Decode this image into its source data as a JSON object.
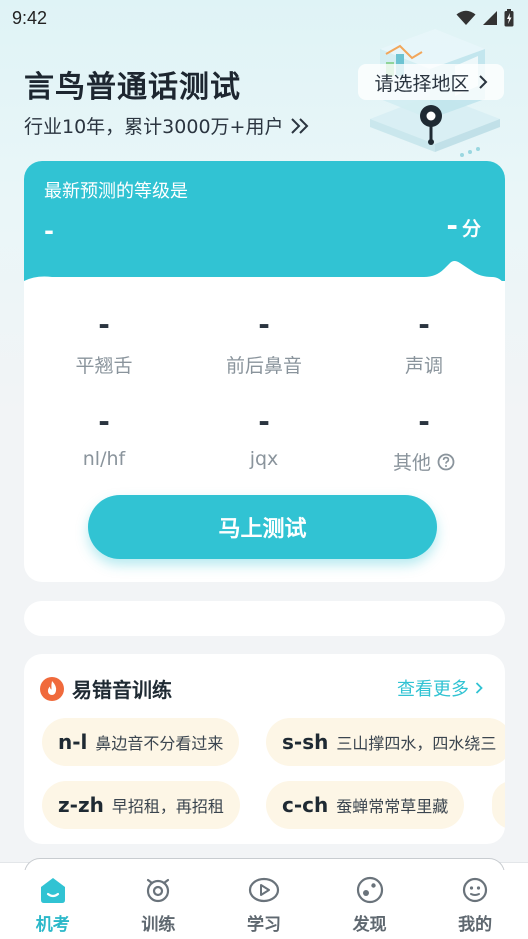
{
  "status_bar": {
    "time": "9:42"
  },
  "header": {
    "title": "言鸟普通话测试",
    "subtitle": "行业10年，累计3000万+用户",
    "region_button": "请选择地区"
  },
  "prediction": {
    "label": "最新预测的等级是",
    "level": "-",
    "score": "-",
    "score_unit": "分",
    "metrics": [
      {
        "value": "-",
        "label": "平翘舌"
      },
      {
        "value": "-",
        "label": "前后鼻音"
      },
      {
        "value": "-",
        "label": "声调"
      },
      {
        "value": "-",
        "label": "nl/hf"
      },
      {
        "value": "-",
        "label": "jqx"
      },
      {
        "value": "-",
        "label": "其他"
      }
    ],
    "test_button": "马上测试"
  },
  "practice": {
    "title": "易错音训练",
    "more_link": "查看更多",
    "items": [
      {
        "code": "n-l",
        "desc": "鼻边音不分看过来"
      },
      {
        "code": "s-sh",
        "desc": "三山撑四水，四水绕三"
      },
      {
        "code": "z-zh",
        "desc": "早招租，再招租"
      },
      {
        "code": "c-ch",
        "desc": "蚕蝉常常草里藏"
      }
    ]
  },
  "tabbar": {
    "tabs": [
      {
        "label": "机考",
        "icon": "exam-icon",
        "active": true
      },
      {
        "label": "训练",
        "icon": "alarm-clock-icon",
        "active": false
      },
      {
        "label": "学习",
        "icon": "play-video-icon",
        "active": false
      },
      {
        "label": "发现",
        "icon": "discover-icon",
        "active": false
      },
      {
        "label": "我的",
        "icon": "profile-face-icon",
        "active": false
      }
    ]
  },
  "colors": {
    "accent": "#31c3d3",
    "pill_bg": "#fdf6e6",
    "flame": "#f06a3c"
  }
}
